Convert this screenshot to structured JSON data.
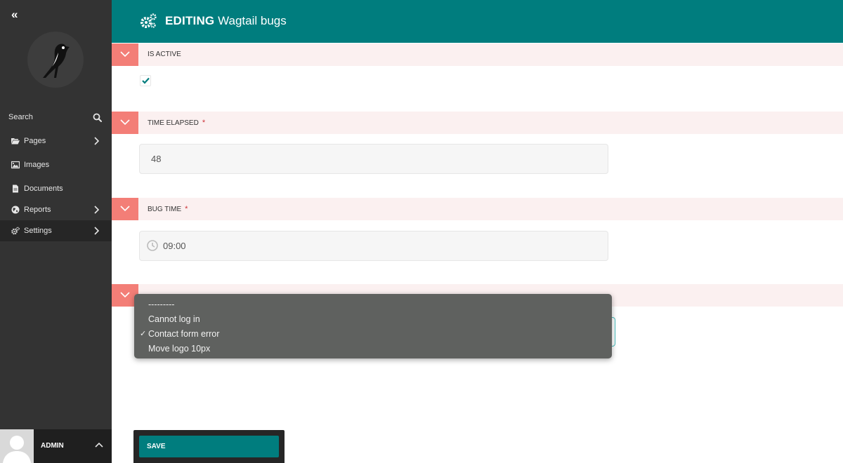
{
  "sidebar": {
    "collapse_label": "«",
    "search_label": "Search",
    "items": [
      {
        "label": "Pages",
        "icon": "folder-open-icon",
        "has_submenu": true
      },
      {
        "label": "Images",
        "icon": "image-icon",
        "has_submenu": false
      },
      {
        "label": "Documents",
        "icon": "document-icon",
        "has_submenu": false
      },
      {
        "label": "Reports",
        "icon": "globe-icon",
        "has_submenu": true
      },
      {
        "label": "Settings",
        "icon": "cogs-icon",
        "has_submenu": true,
        "active": true
      }
    ],
    "account": {
      "name": "ADMIN"
    }
  },
  "header": {
    "action": "EDITING",
    "title": "Wagtail bugs",
    "icon": "cogs-icon"
  },
  "form": {
    "is_active": {
      "label": "IS ACTIVE",
      "checked": true
    },
    "time_elapsed": {
      "label": "TIME ELAPSED",
      "required_mark": "*",
      "value": "48"
    },
    "bug_time": {
      "label": "BUG TIME",
      "required_mark": "*",
      "value": "09:00"
    },
    "bugs": {
      "options": [
        "---------",
        "Cannot log in",
        "Contact form error",
        "Move logo 10px"
      ],
      "selected_index": 2,
      "check_mark": "✓"
    }
  },
  "footer": {
    "save_label": "SAVE"
  },
  "colors": {
    "brand": "#007d7e",
    "sidebar": "#333333",
    "section_toggle": "#f37e77",
    "section_bar": "#fbf0f0",
    "required": "#cd3238"
  }
}
